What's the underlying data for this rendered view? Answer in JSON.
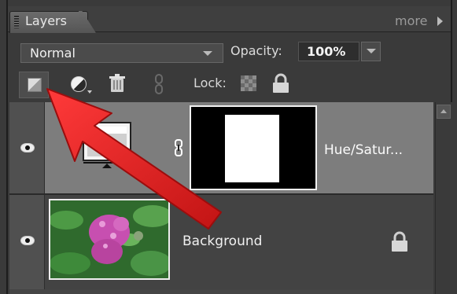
{
  "panel": {
    "tab_label": "Layers",
    "more_label": "more",
    "more_icon": "chevron-right-icon"
  },
  "controls": {
    "blend_mode": "Normal",
    "opacity_label": "Opacity:",
    "opacity_value": "100%",
    "lock_label": "Lock:"
  },
  "toolbar": {
    "icons": [
      "new-layer-icon",
      "adjustment-layer-icon",
      "trash-icon",
      "link-icon",
      "lock-transparent-icon",
      "lock-all-icon"
    ]
  },
  "layers": [
    {
      "name": "Hue/Satur...",
      "visible": true,
      "type": "adjustment",
      "has_mask": true
    },
    {
      "name": "Background",
      "visible": true,
      "type": "image",
      "locked": true
    }
  ],
  "colors": {
    "panel_bg": "#3a3a3a",
    "selected_row": "#7d7d7d",
    "annotation_arrow": "#e01f1f"
  }
}
